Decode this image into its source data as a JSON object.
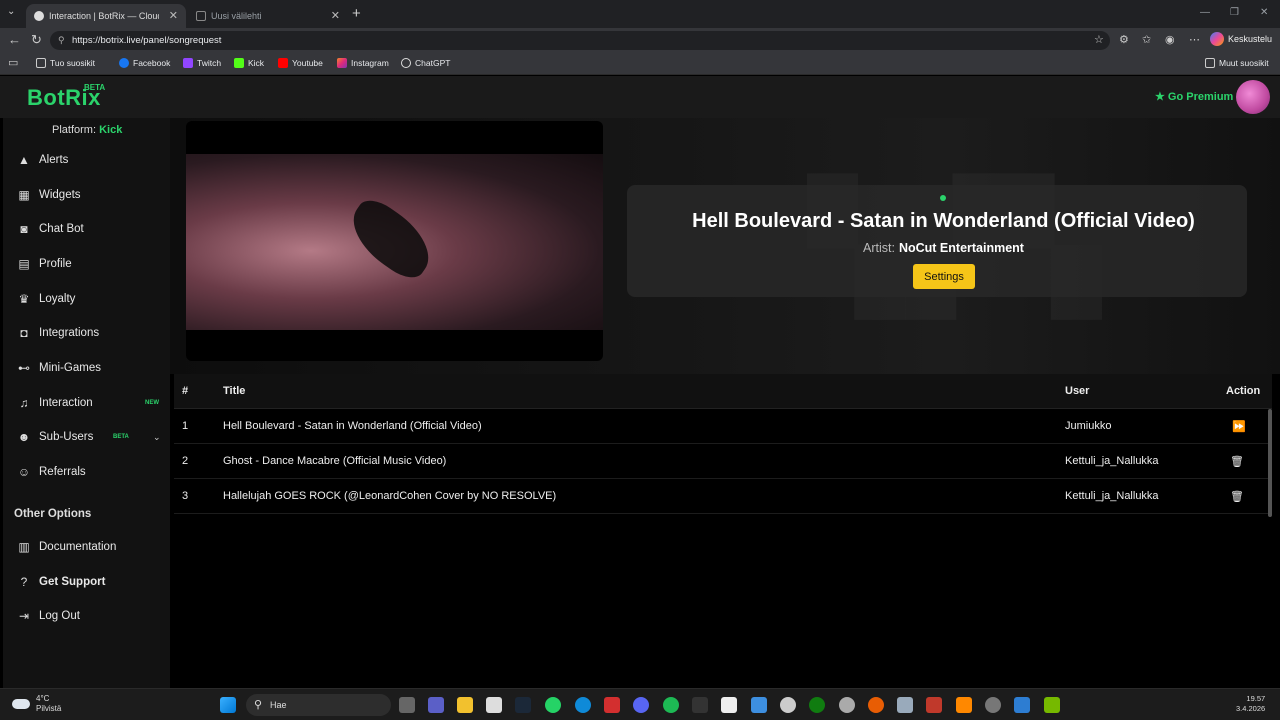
{
  "browser": {
    "tabs": [
      {
        "title": "Interaction | BotRix — Cloud",
        "active": true
      },
      {
        "title": "Uusi välilehti",
        "active": false
      }
    ],
    "url": "https://botrix.live/panel/songrequest",
    "profile_button": "Keskustelu",
    "bookmarks": [
      "Tuo suosikit",
      "Facebook",
      "Twitch",
      "Kick",
      "Youtube",
      "Instagram",
      "ChatGPT"
    ],
    "other_bookmarks": "Muut suosikit"
  },
  "app": {
    "logo": "BotRix",
    "logo_badge": "BETA",
    "premium_label": "Go Premium",
    "platform_label": "Platform:",
    "platform_value": "Kick",
    "nav": [
      {
        "label": "Alerts",
        "icon": "warning-icon"
      },
      {
        "label": "Widgets",
        "icon": "grid-icon"
      },
      {
        "label": "Chat Bot",
        "icon": "robot-icon"
      },
      {
        "label": "Profile",
        "icon": "id-card-icon"
      },
      {
        "label": "Loyalty",
        "icon": "trophy-icon"
      },
      {
        "label": "Integrations",
        "icon": "discord-icon"
      },
      {
        "label": "Mini-Games",
        "icon": "gamepad-icon"
      },
      {
        "label": "Interaction",
        "icon": "music-icon",
        "tag": "NEW"
      },
      {
        "label": "Sub-Users",
        "icon": "users-icon",
        "tag": "BETA"
      },
      {
        "label": "Referrals",
        "icon": "user-group-icon"
      }
    ],
    "other_options_title": "Other Options",
    "other_nav": [
      {
        "label": "Documentation",
        "icon": "book-icon"
      },
      {
        "label": "Get Support",
        "icon": "question-icon"
      },
      {
        "label": "Log Out",
        "icon": "logout-icon"
      }
    ]
  },
  "now_playing": {
    "title": "Hell Boulevard - Satan in Wonderland (Official Video)",
    "artist_label": "Artist:",
    "artist": "NoCut Entertainment",
    "settings_label": "Settings"
  },
  "queue": {
    "headers": {
      "num": "#",
      "title": "Title",
      "user": "User",
      "action": "Action"
    },
    "rows": [
      {
        "num": "1",
        "title": "Hell Boulevard - Satan in Wonderland (Official Video)",
        "user": "Jumiukko",
        "action": "skip-icon"
      },
      {
        "num": "2",
        "title": "Ghost - Dance Macabre (Official Music Video)",
        "user": "Kettuli_ja_Nallukka",
        "action": "trash-icon"
      },
      {
        "num": "3",
        "title": "Hallelujah GOES ROCK (@LeonardCohen Cover by NO RESOLVE)",
        "user": "Kettuli_ja_Nallukka",
        "action": "trash-icon"
      }
    ]
  },
  "taskbar": {
    "weather_temp": "4°C",
    "weather_desc": "Pilvistä",
    "search_placeholder": "Hae",
    "time": "19.57",
    "date": "3.4.2026"
  },
  "colors": {
    "accent": "#2bd36b",
    "settings_button": "#f5c518"
  }
}
